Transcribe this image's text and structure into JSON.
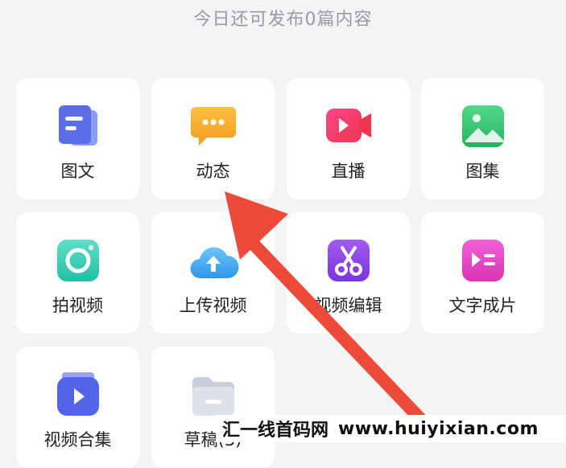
{
  "header": {
    "quota_text": "今日还可发布0篇内容"
  },
  "grid": {
    "items": [
      {
        "label": "图文",
        "icon": "image-text-icon",
        "color": "#5b6ee8"
      },
      {
        "label": "动态",
        "icon": "moment-chat-icon",
        "color": "#f7a823"
      },
      {
        "label": "直播",
        "icon": "live-camera-icon",
        "color": "#f2396b"
      },
      {
        "label": "图集",
        "icon": "gallery-icon",
        "color": "#33c26a"
      },
      {
        "label": "拍视频",
        "icon": "shoot-video-icon",
        "color": "#34ccb4"
      },
      {
        "label": "上传视频",
        "icon": "upload-cloud-icon",
        "color": "#3aa7f2"
      },
      {
        "label": "视频编辑",
        "icon": "scissors-icon",
        "color": "#8a43e6"
      },
      {
        "label": "文字成片",
        "icon": "text-to-video-icon",
        "color": "#e346c8"
      },
      {
        "label": "视频合集",
        "icon": "video-collection-icon",
        "color": "#5563e8"
      },
      {
        "label": "草稿(3)",
        "icon": "drafts-folder-icon",
        "color": "#c9cedc"
      }
    ]
  },
  "watermark": {
    "site_cn": "汇一线首码网",
    "site_url": "www.huiyixian.com"
  },
  "annotation": {
    "arrow_color": "#ee4a3a"
  }
}
